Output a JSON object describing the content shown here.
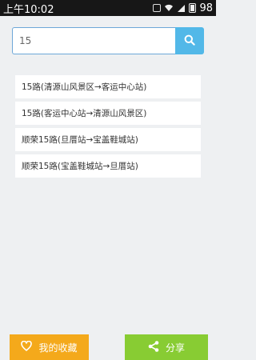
{
  "status_bar": {
    "time": "上午10:02",
    "battery": "98"
  },
  "search": {
    "value": "15",
    "icon": "search-icon"
  },
  "results": [
    {
      "label": "15路(清源山风景区→客运中心站)"
    },
    {
      "label": "15路(客运中心站→清源山风景区)"
    },
    {
      "label": "顺荣15路(旦厝站→宝盖鞋城站)"
    },
    {
      "label": "顺荣15路(宝盖鞋城站→旦厝站)"
    }
  ],
  "bottom": {
    "favorites_label": "我的收藏",
    "favorites_icon": "heart-icon",
    "favorites_color": "#f4a91b",
    "share_label": "分享",
    "share_icon": "share-icon",
    "share_color": "#88cc33"
  },
  "colors": {
    "accent": "#52b8e8",
    "status_bar_bg": "#171717",
    "page_bg": "#eef0f2"
  }
}
